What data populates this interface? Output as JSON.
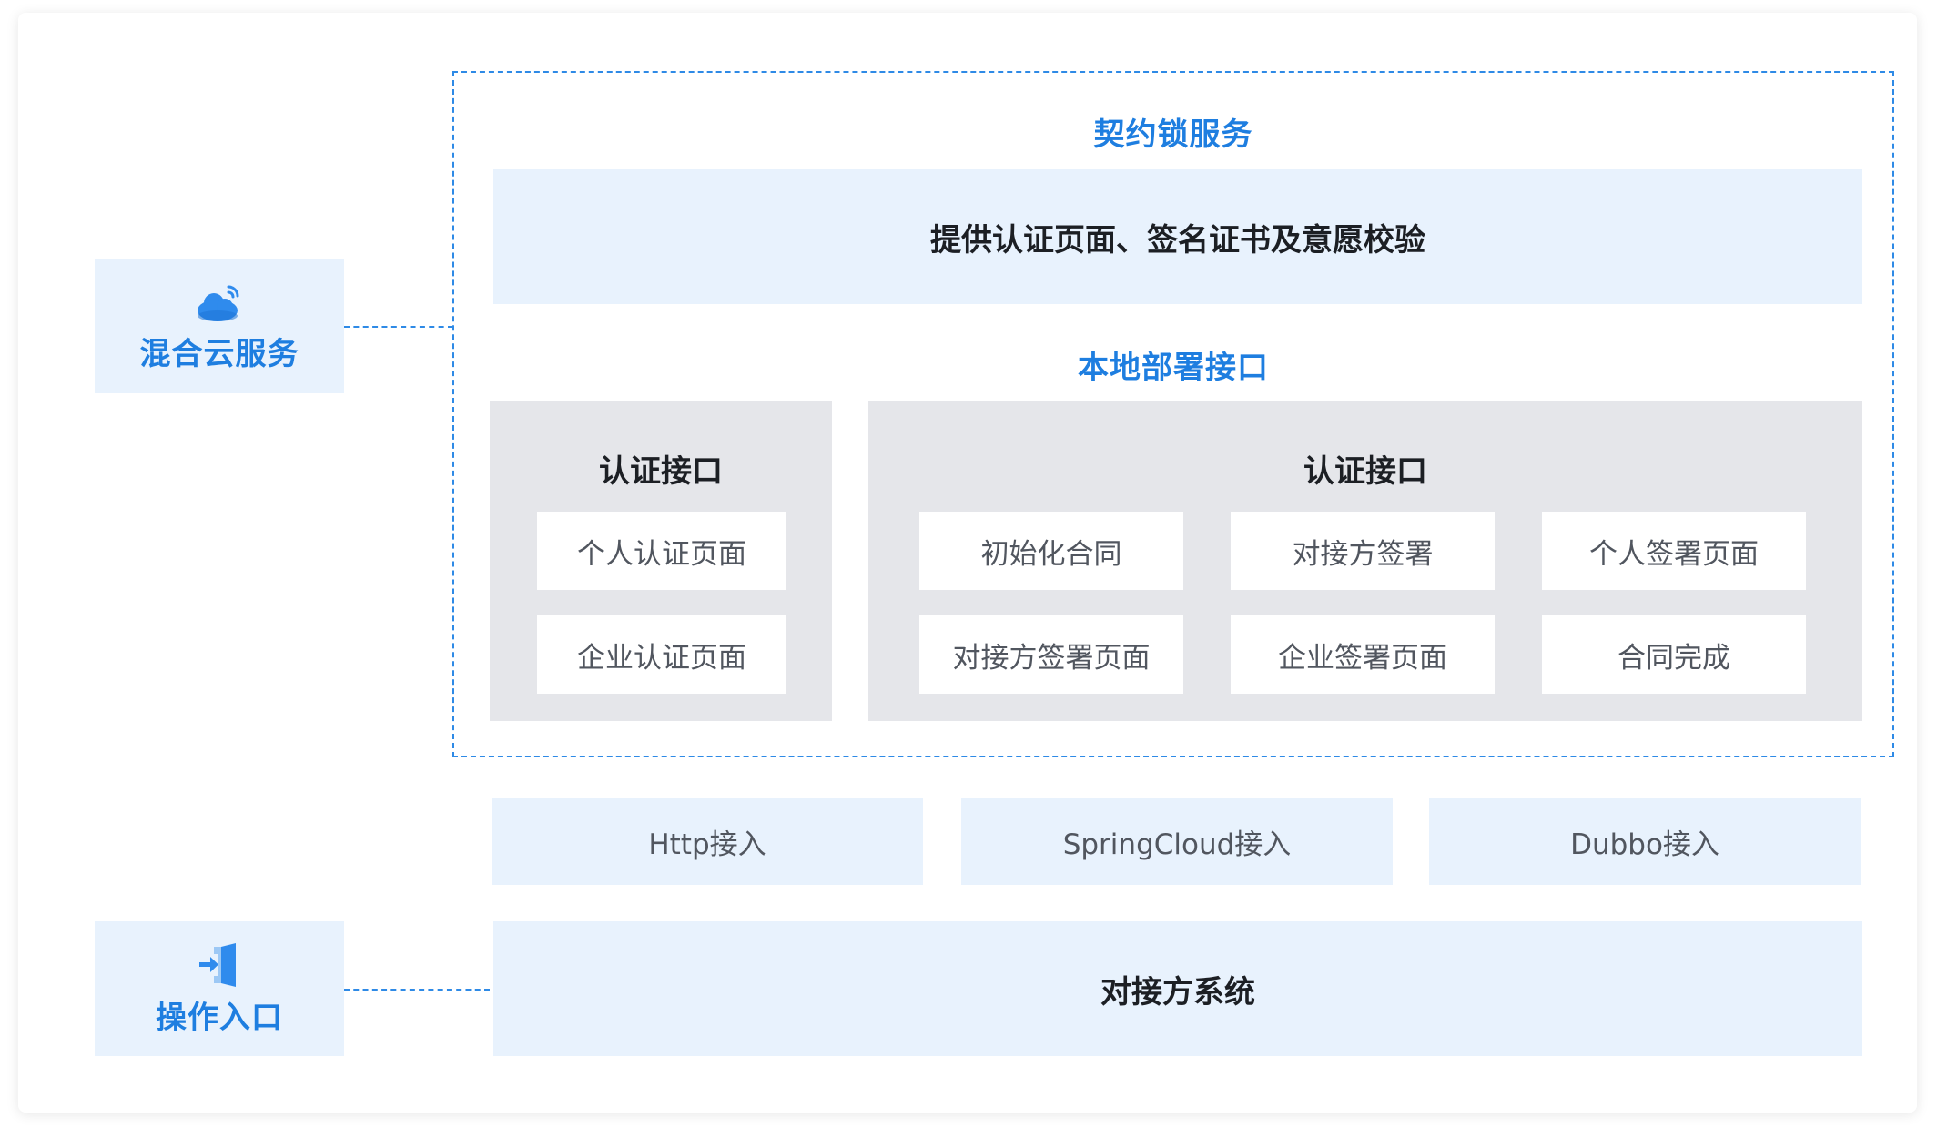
{
  "left_panels": {
    "hybrid_cloud": {
      "label": "混合云服务",
      "icon": "cloud-icon"
    },
    "entry": {
      "label": "操作入口",
      "icon": "enter-door-icon"
    }
  },
  "contract_lock": {
    "title": "契约锁服务",
    "top_bar": "提供认证页面、签名证书及意愿校验",
    "local_title": "本地部署接口",
    "auth_group": {
      "title": "认证接口",
      "items": [
        "个人认证页面",
        "企业认证页面"
      ]
    },
    "sign_group": {
      "title": "认证接口",
      "items": [
        "初始化合同",
        "对接方签署",
        "个人签署页面",
        "对接方签署页面",
        "企业签署页面",
        "合同完成"
      ]
    }
  },
  "access": {
    "items": [
      "Http接入",
      "SpringCloud接入",
      "Dubbo接入"
    ]
  },
  "integrator": {
    "label": "对接方系统"
  },
  "colors": {
    "accent": "#1e7ee0",
    "light_blue_panel": "#e8f2fd",
    "grey_panel": "#e5e6ea",
    "dashed": "#2e8ae6"
  }
}
